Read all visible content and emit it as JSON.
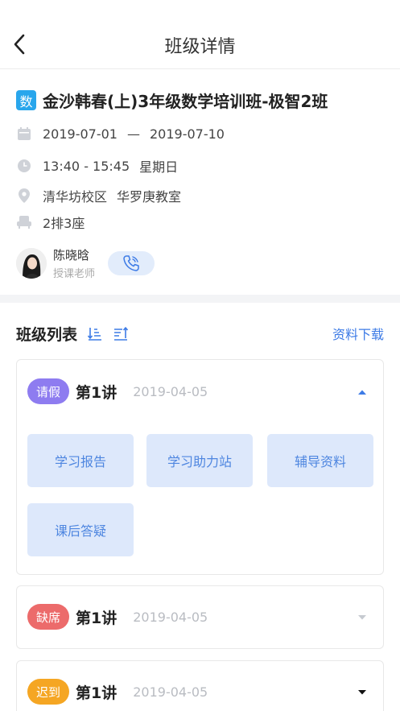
{
  "header": {
    "title": "班级详情"
  },
  "class_info": {
    "badge": "数",
    "name": "金沙韩春(上)3年级数学培训班-极智2班",
    "date_start": "2019-07-01",
    "date_sep": "—",
    "date_end": "2019-07-10",
    "time": "13:40 - 15:45",
    "weekday": "星期日",
    "campus": "清华坊校区",
    "classroom": "华罗庚教室",
    "seat": "2排3座"
  },
  "teacher": {
    "name": "陈晓晗",
    "role": "授课老师"
  },
  "list": {
    "title": "班级列表",
    "download": "资料下载"
  },
  "lessons": [
    {
      "tag": "请假",
      "tag_color": "#8e7cf0",
      "title": "第1讲",
      "date": "2019-04-05",
      "expanded": true,
      "actions": [
        "学习报告",
        "学习助力站",
        "辅导资料",
        "课后答疑"
      ]
    },
    {
      "tag": "缺席",
      "tag_color": "#ec6b6b",
      "title": "第1讲",
      "date": "2019-04-05",
      "expanded": false
    },
    {
      "tag": "迟到",
      "tag_color": "#f5a623",
      "title": "第1讲",
      "date": "2019-04-05",
      "expanded": false
    }
  ],
  "colors": {
    "accent": "#3d7be6",
    "badge": "#29a6ec"
  }
}
